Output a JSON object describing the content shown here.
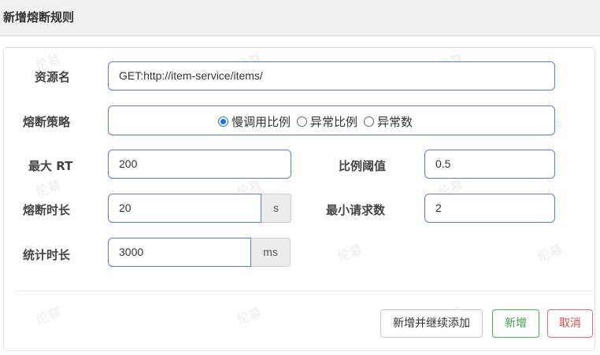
{
  "dialog": {
    "title": "新增熔断规则"
  },
  "form": {
    "resource": {
      "label": "资源名",
      "value": "GET:http://item-service/items/"
    },
    "strategy": {
      "label": "熔断策略",
      "options": [
        "慢调用比例",
        "异常比例",
        "异常数"
      ],
      "selected": "慢调用比例"
    },
    "max_rt": {
      "label": "最大 RT",
      "value": "200"
    },
    "ratio_threshold": {
      "label": "比例阈值",
      "value": "0.5"
    },
    "break_duration": {
      "label": "熔断时长",
      "value": "20",
      "unit": "s"
    },
    "min_requests": {
      "label": "最小请求数",
      "value": "2"
    },
    "stat_duration": {
      "label": "统计时长",
      "value": "3000",
      "unit": "ms"
    }
  },
  "buttons": {
    "continue_label": "新增并继续添加",
    "add_label": "新增",
    "cancel_label": "取消"
  },
  "watermark": {
    "text": "伦慕"
  },
  "colors": {
    "input_border": "#5b7fbe",
    "radio_checked": "#1a73e8",
    "add_button": "#44b04d",
    "cancel_button": "#e36d72",
    "header_bg": "#f1f1f1"
  }
}
